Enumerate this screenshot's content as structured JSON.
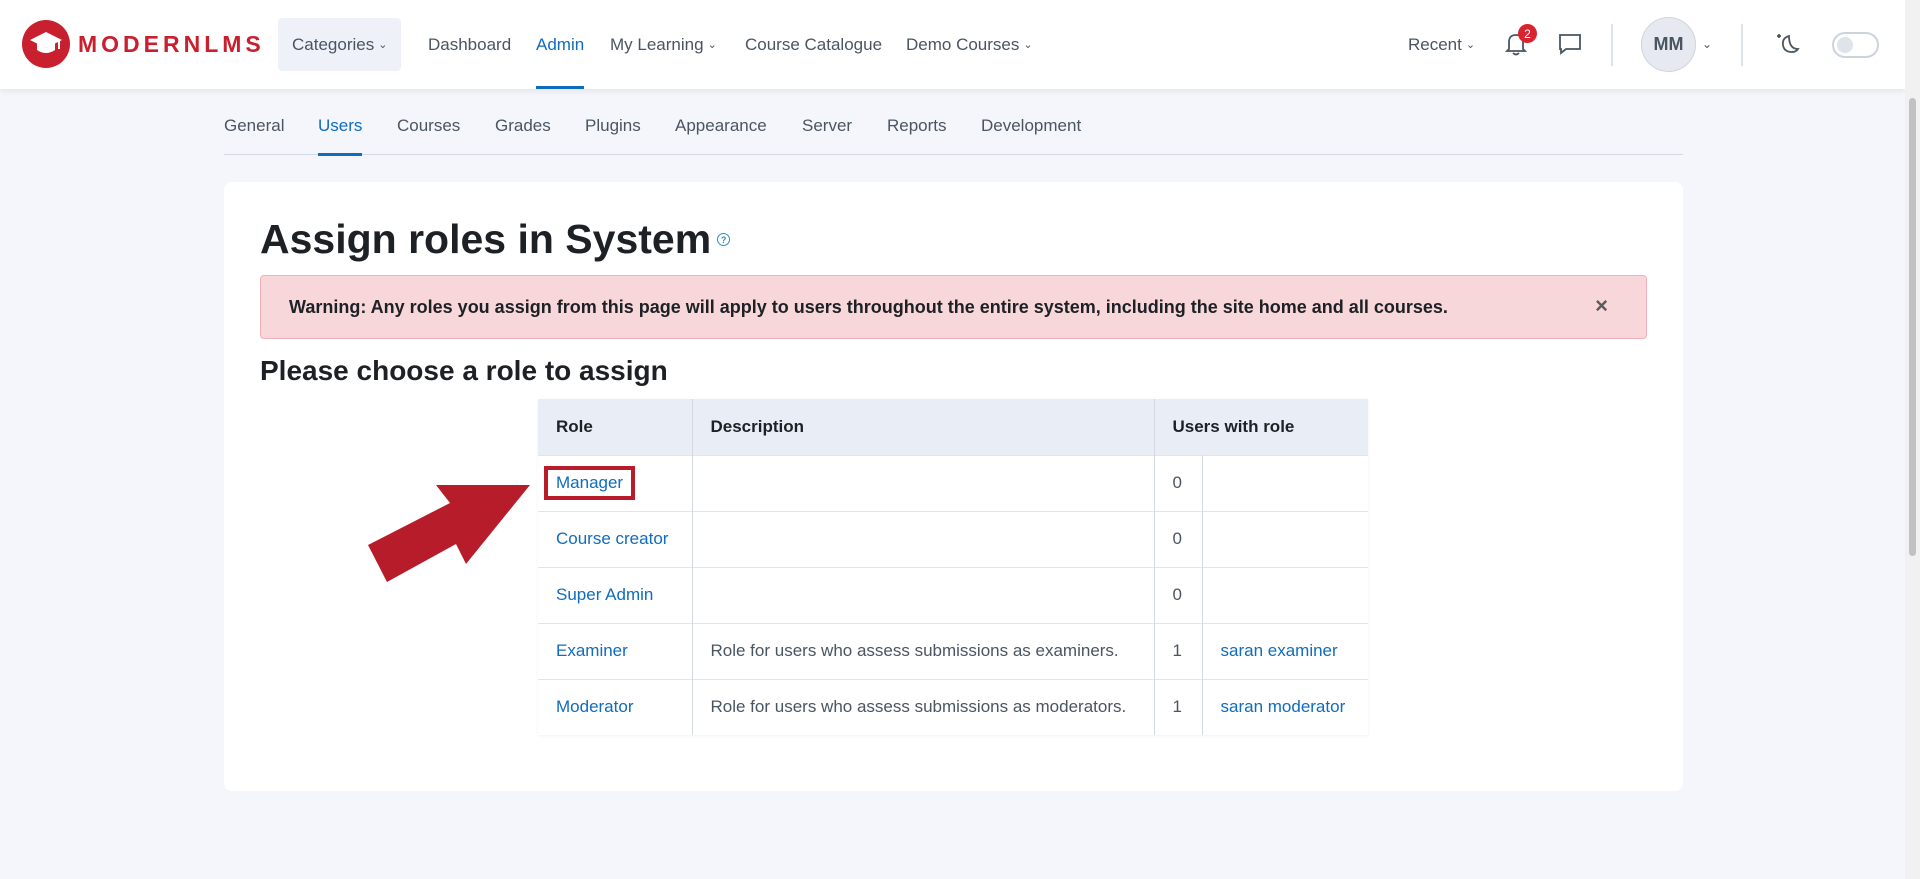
{
  "brand": {
    "logo_text": "MODERNLMS",
    "color": "#c8202f"
  },
  "nav": {
    "categories": "Categories",
    "dashboard": "Dashboard",
    "admin": "Admin",
    "my_learning": "My Learning",
    "course_catalogue": "Course Catalogue",
    "demo_courses": "Demo Courses",
    "recent": "Recent",
    "notification_count": "2",
    "avatar_initials": "MM"
  },
  "admin_tabs": [
    "General",
    "Users",
    "Courses",
    "Grades",
    "Plugins",
    "Appearance",
    "Server",
    "Reports",
    "Development"
  ],
  "page": {
    "title": "Assign roles in System",
    "help_glyph": "?",
    "warning": "Warning: Any roles you assign from this page will apply to users throughout the entire system, including the site home and all courses.",
    "close_glyph": "×",
    "subheading": "Please choose a role to assign"
  },
  "table": {
    "headers": {
      "role": "Role",
      "description": "Description",
      "users_with_role": "Users with role"
    },
    "rows": [
      {
        "role": "Manager",
        "description": "",
        "count": "0",
        "users": ""
      },
      {
        "role": "Course creator",
        "description": "",
        "count": "0",
        "users": ""
      },
      {
        "role": "Super Admin",
        "description": "",
        "count": "0",
        "users": ""
      },
      {
        "role": "Examiner",
        "description": "Role for users who assess submissions as examiners.",
        "count": "1",
        "users": "saran examiner"
      },
      {
        "role": "Moderator",
        "description": "Role for users who assess submissions as moderators.",
        "count": "1",
        "users": "saran moderator"
      }
    ]
  },
  "colors": {
    "link": "#0f6cbf",
    "annotation": "#b71c2b",
    "alert_bg": "#f8d7da"
  },
  "icons": [
    "graduation-cap-icon",
    "bell-icon",
    "chat-icon",
    "chevron-down-icon",
    "dark-mode-icon",
    "close-icon",
    "help-icon",
    "annotation-arrow"
  ]
}
